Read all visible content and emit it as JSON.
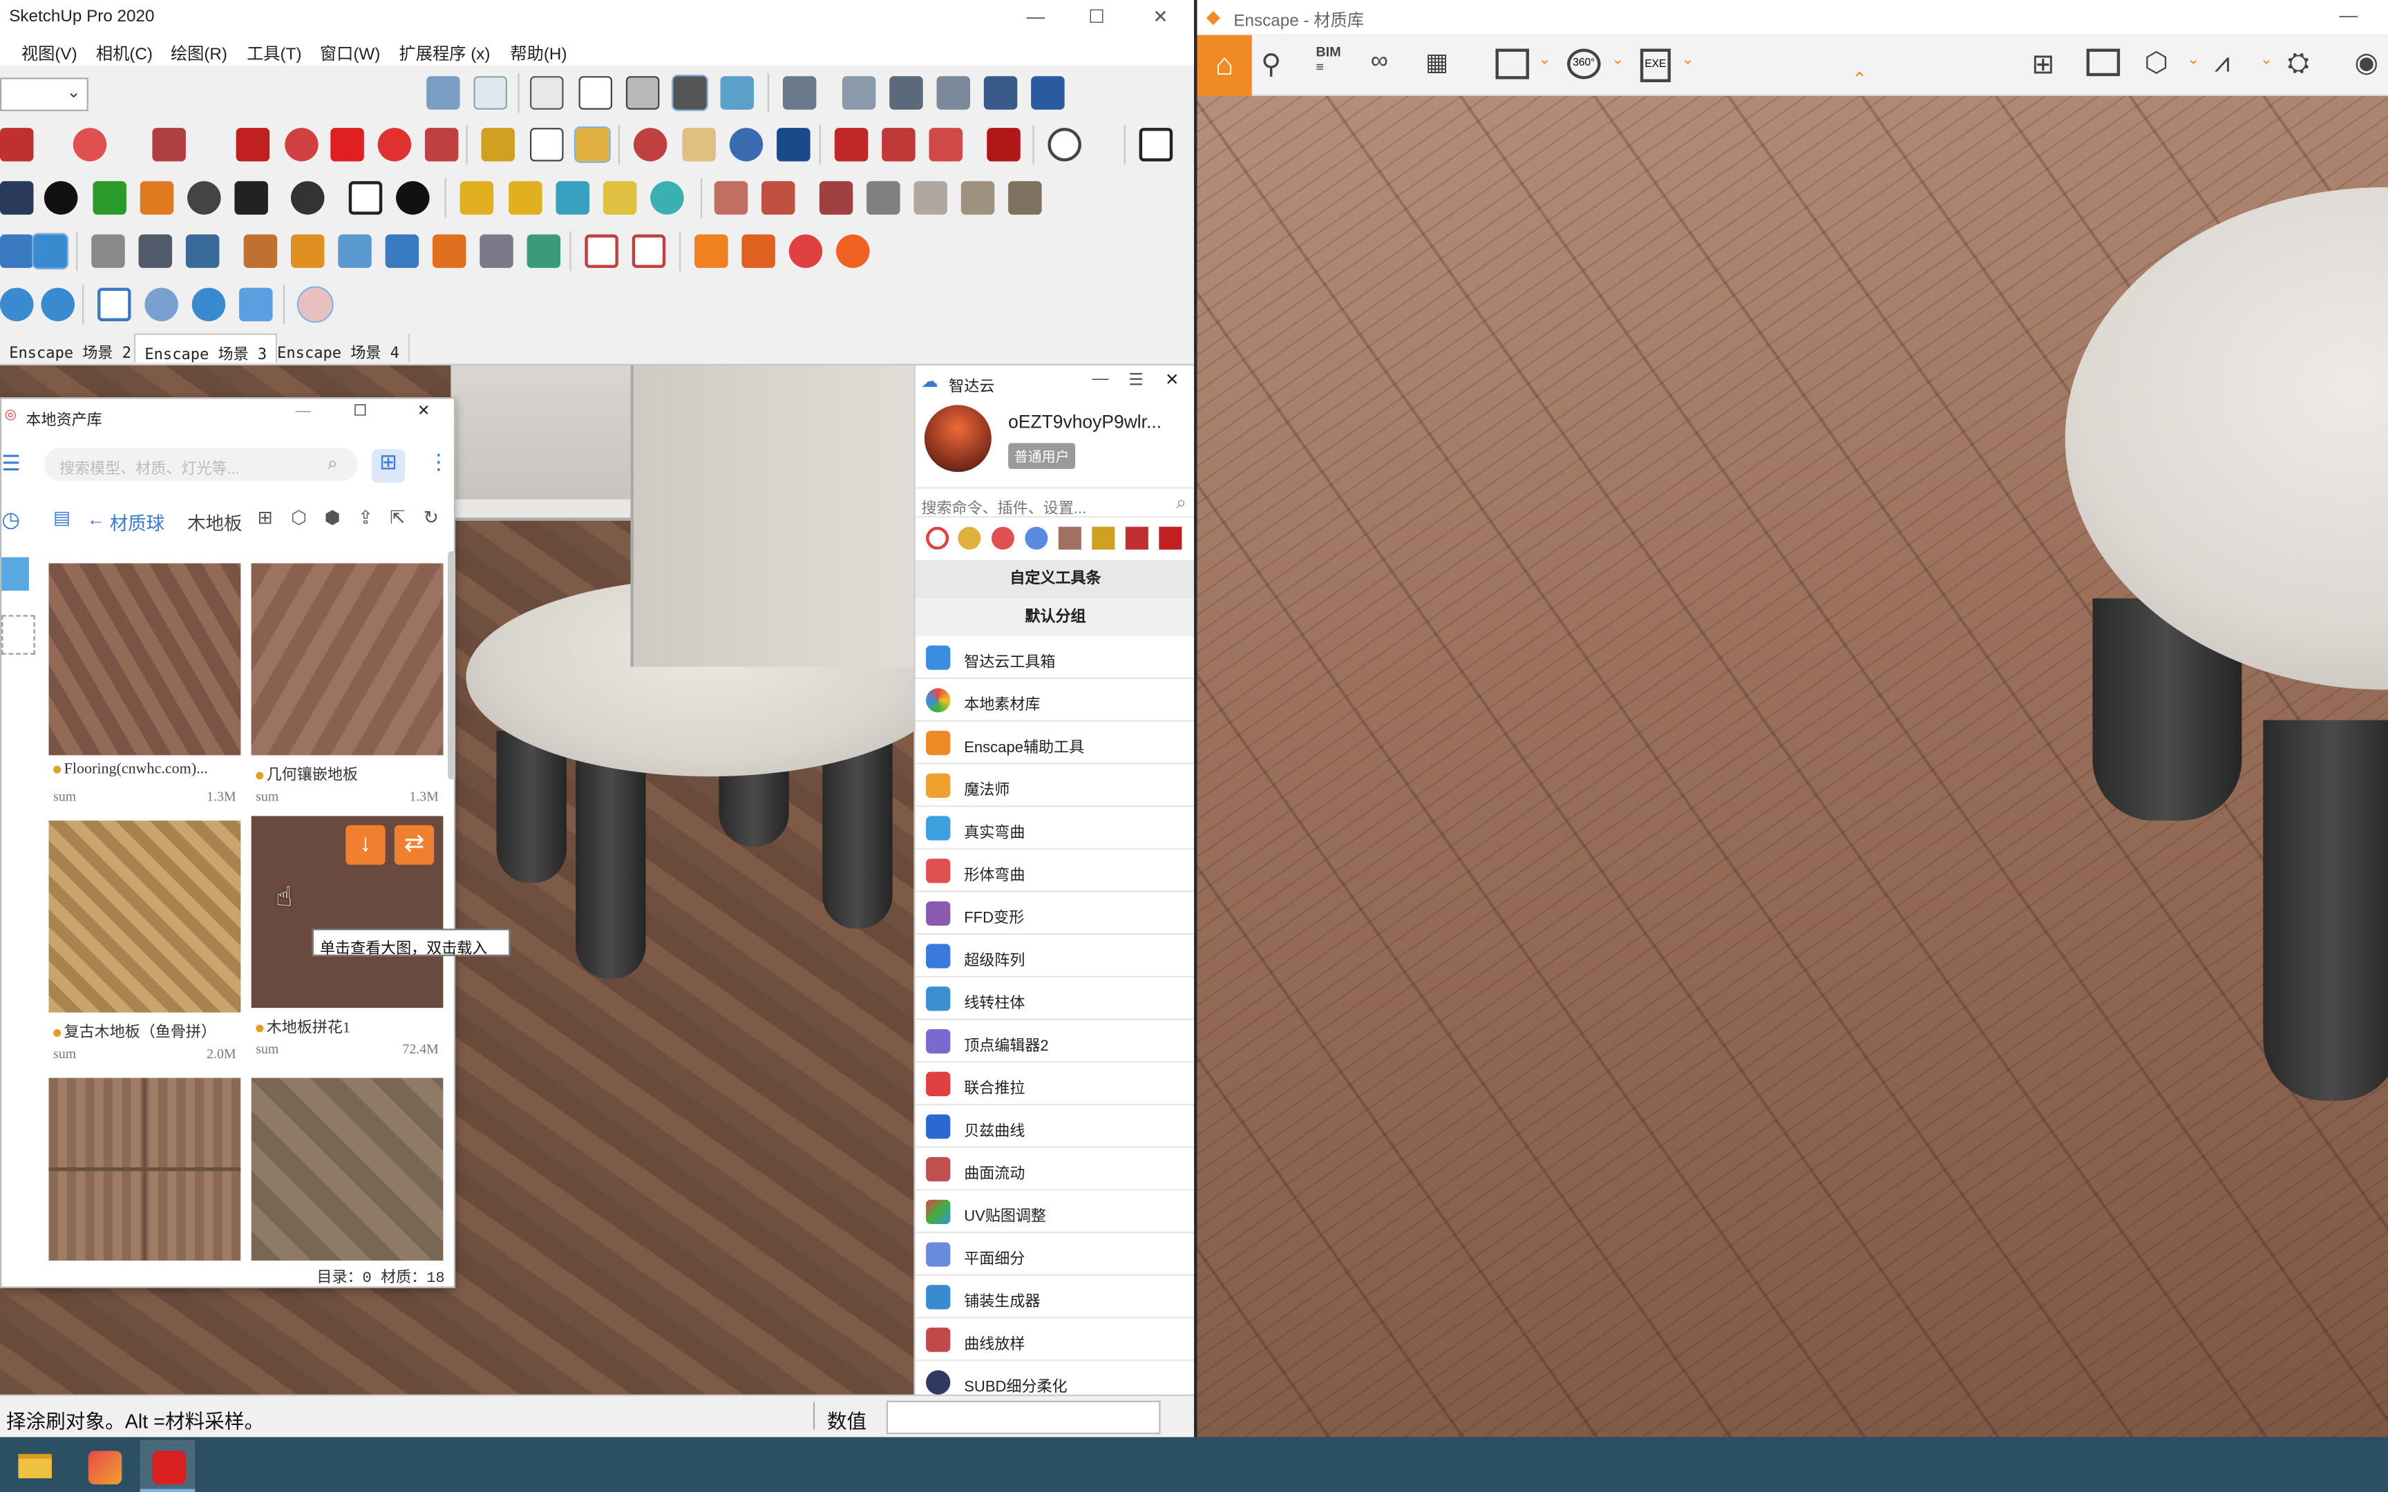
{
  "sketchup": {
    "title": "SketchUp Pro 2020",
    "menus": [
      "视图(V)",
      "相机(C)",
      "绘图(R)",
      "工具(T)",
      "窗口(W)",
      "扩展程序 (x)",
      "帮助(H)"
    ],
    "scene_tabs": [
      "Enscape 场景 2",
      "Enscape 场景 3",
      "Enscape 场景 4"
    ],
    "active_tab": 1,
    "status_text": "择涂刷对象。Alt =材料采样。",
    "value_label": "数值"
  },
  "asset_library": {
    "title": "本地资产库",
    "search_placeholder": "搜索模型、材质、灯光等...",
    "breadcrumb_back": "材质球",
    "breadcrumb_current": "木地板",
    "items": [
      {
        "name": "Flooring(cnwhc.com)...",
        "type": "sum",
        "size": "1.3M"
      },
      {
        "name": "几何镶嵌地板",
        "type": "sum",
        "size": "1.3M"
      },
      {
        "name": "复古木地板（鱼骨拼）",
        "type": "sum",
        "size": "2.0M"
      },
      {
        "name": "木地板拼花1",
        "type": "sum",
        "size": "72.4M"
      }
    ],
    "tooltip": "单击查看大图，双击载入",
    "footer": "目录：0 材质：18"
  },
  "zhidayun": {
    "title": "智达云",
    "username": "oEZT9vhoyP9wlr...",
    "user_level": "普通用户",
    "search_placeholder": "搜索命令、插件、设置...",
    "section_custom": "自定义工具条",
    "section_default": "默认分组",
    "tools": [
      "智达云工具箱",
      "本地素材库",
      "Enscape辅助工具",
      "魔法师",
      "真实弯曲",
      "形体弯曲",
      "FFD变形",
      "超级阵列",
      "线转柱体",
      "顶点编辑器2",
      "联合推拉",
      "贝兹曲线",
      "曲面流动",
      "UV贴图调整",
      "平面细分",
      "铺装生成器",
      "曲线放样",
      "SUBD细分柔化"
    ],
    "tool_colors": [
      "#3a8de0",
      "#e84a4a",
      "#f08a24",
      "#f0a030",
      "#3aa0e0",
      "#e05050",
      "#8a5ab0",
      "#3a7ae0",
      "#3a90d0",
      "#7a6ad0",
      "#e04040",
      "#2a6ad0",
      "#c05050",
      "#5ab050",
      "#6a8ae0",
      "#3a8ad0",
      "#c04a4a",
      "#303a60"
    ]
  },
  "enscape": {
    "title": "Enscape - 材质库",
    "toolbar_icons": [
      "home-icon",
      "location-pin-icon",
      "bim-icon",
      "binoculars-icon",
      "clapper-icon",
      "screenshot-icon",
      "panorama-360-icon",
      "export-exe-icon",
      "map-icon",
      "video-icon",
      "cube-icon",
      "asset-library-icon",
      "settings-icon",
      "visibility-icon"
    ]
  }
}
